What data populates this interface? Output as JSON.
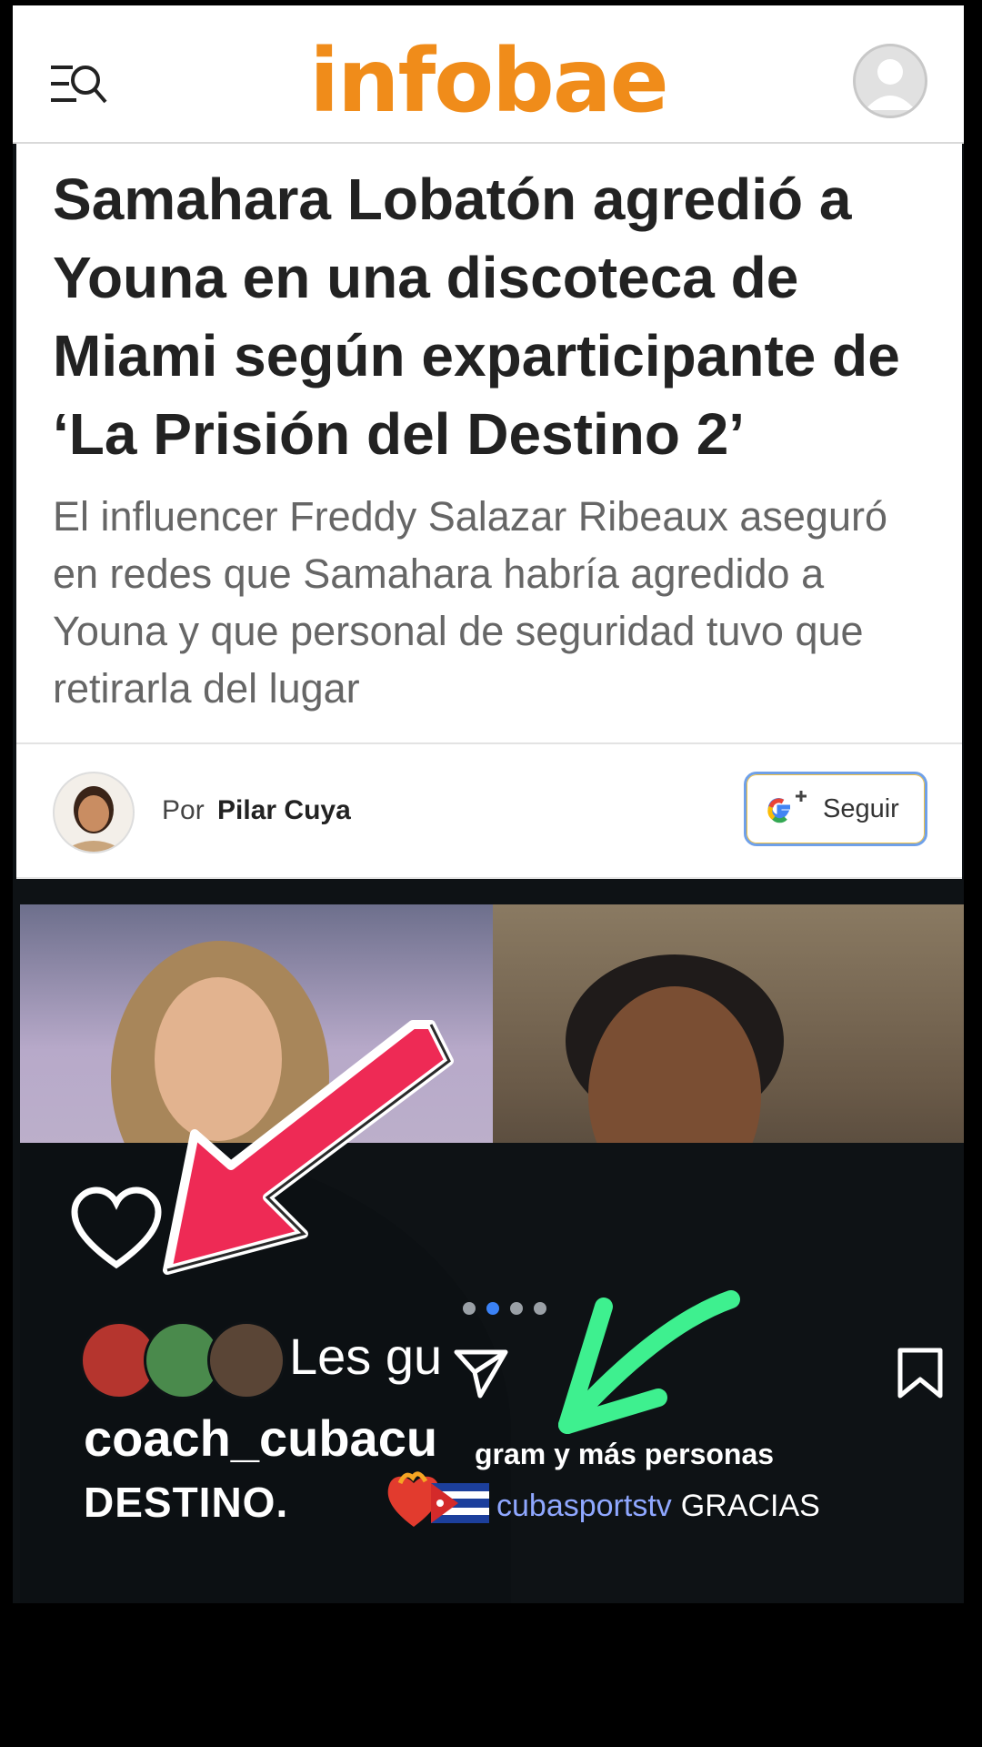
{
  "header": {
    "logo": "infobae",
    "menu_icon": "menu-search-icon",
    "account_icon": "user-avatar-icon"
  },
  "article": {
    "headline": "Samahara Lobatón agredió a Youna en una discoteca de Miami según exparticipante de ‘La Prisión del Destino 2’",
    "subhead": "El influencer Freddy Salazar Ribeaux aseguró en redes que Samahara habría agredido a Youna y que personal de seguridad tuvo que retirarla del lugar",
    "byline_prefix": "Por",
    "author": "Pilar Cuya",
    "follow_label": "Seguir"
  },
  "instagram": {
    "likes_text": "Les gu",
    "liked_by_more": "gram y más personas",
    "username": "coach_cubacu",
    "caption": "DESTINO.",
    "mention": "cubasportstv",
    "mention_rest": "GRACIAS",
    "carousel_dots": 4,
    "active_dot": 1
  },
  "colors": {
    "logo": "#f08c1a",
    "red_arrow": "#ee2a55",
    "green_arrow": "#3ef08f",
    "mention": "#8fa7ff"
  }
}
